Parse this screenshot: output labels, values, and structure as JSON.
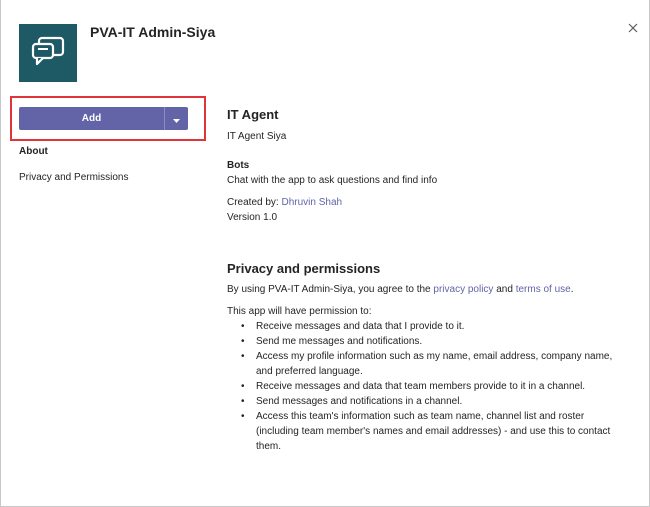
{
  "header": {
    "app_name": "PVA-IT Admin-Siya",
    "close_icon": "close-icon",
    "app_icon": "chat-bubble-icon",
    "app_icon_bg": "#1d5a66"
  },
  "actions": {
    "add_label": "Add",
    "dropdown_icon": "chevron-down-icon",
    "accent": "#6264a7",
    "highlight_color": "#e1333a"
  },
  "sidebar": {
    "items": [
      {
        "label": "About",
        "active": true
      },
      {
        "label": "Privacy and Permissions",
        "active": false
      }
    ]
  },
  "about": {
    "title": "IT Agent",
    "subtitle": "IT Agent Siya",
    "bots_heading": "Bots",
    "bots_description": "Chat with the app to ask questions and find info",
    "created_by_label": "Created by:",
    "created_by_name": "Dhruvin Shah",
    "version": "Version 1.0"
  },
  "privacy": {
    "heading": "Privacy and permissions",
    "agree_prefix": "By using PVA-IT Admin-Siya, you agree to the",
    "privacy_policy_link": "privacy policy",
    "and_text": "and",
    "terms_link": "terms of use",
    "agree_suffix": ".",
    "permission_intro": "This app will have permission to:",
    "permissions": [
      "Receive messages and data that I provide to it.",
      "Send me messages and notifications.",
      "Access my profile information such as my name, email address, company name, and preferred language.",
      "Receive messages and data that team members provide to it in a channel.",
      "Send messages and notifications in a channel.",
      "Access this team's information such as team name, channel list and roster (including team member's names and email addresses) - and use this to contact them."
    ]
  }
}
